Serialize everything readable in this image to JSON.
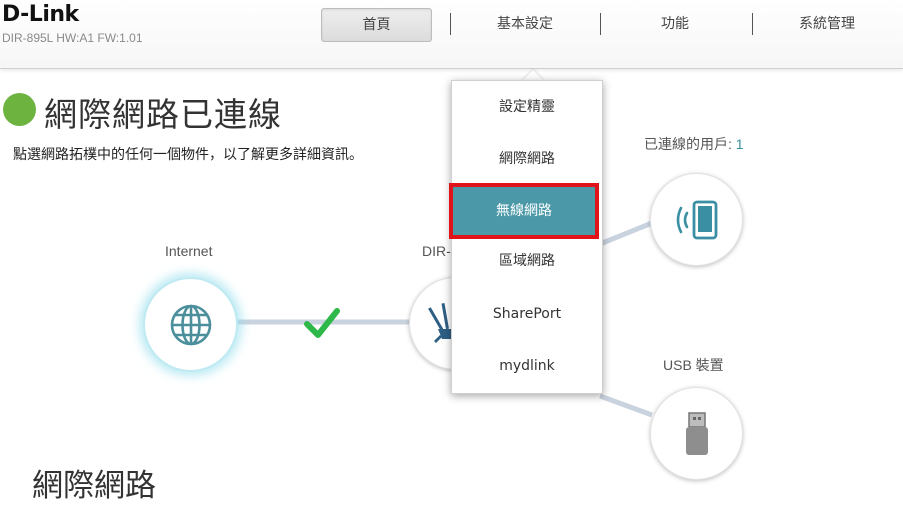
{
  "brand": {
    "logo_text": "D-Link",
    "model_info": "DIR-895L HW:A1 FW:1.01"
  },
  "nav": {
    "items": [
      {
        "label": "首頁",
        "active": true
      },
      {
        "label": "基本設定",
        "active": false
      },
      {
        "label": "功能",
        "active": false
      },
      {
        "label": "系統管理",
        "active": false
      }
    ]
  },
  "status": {
    "title": "網際網路已連線",
    "description": "點選網路拓樸中的任何一個物件，以了解更多詳細資訊。",
    "dot_color": "#6cb33f"
  },
  "topology": {
    "internet_label": "Internet",
    "router_label": "DIR-",
    "clients_label": "已連線的用戶:",
    "clients_count": "1",
    "usb_label": "USB 裝置",
    "link_ok_color": "#2fb84a"
  },
  "dropdown": {
    "items": [
      {
        "label": "設定精靈",
        "selected": false
      },
      {
        "label": "網際網路",
        "selected": false
      },
      {
        "label": "無線網路",
        "selected": true
      },
      {
        "label": "區域網路",
        "selected": false
      },
      {
        "label": "SharePort",
        "selected": false
      },
      {
        "label": "mydlink",
        "selected": false
      }
    ],
    "highlight_color": "#4a98a8",
    "selection_border_color": "#e0121a"
  },
  "section": {
    "title": "網際網路"
  },
  "icons": {
    "internet": "globe-icon",
    "router": "router-icon",
    "clients": "tablet-wifi-icon",
    "usb": "usb-drive-icon",
    "link_status": "check-icon"
  }
}
